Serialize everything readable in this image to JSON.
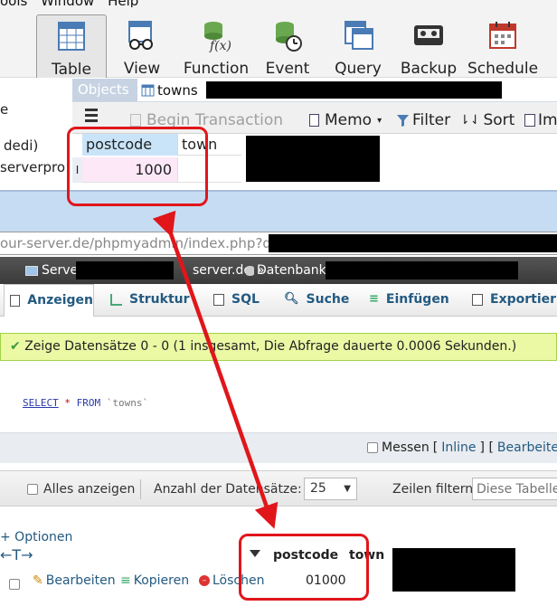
{
  "menubar": {
    "items": [
      "ools",
      "Window",
      "Help"
    ]
  },
  "toolbar": {
    "buttons": [
      {
        "label": "Table",
        "icon": "table-icon",
        "active": true
      },
      {
        "label": "View",
        "icon": "view-icon"
      },
      {
        "label": "Function",
        "icon": "function-icon"
      },
      {
        "label": "Event",
        "icon": "event-icon"
      },
      {
        "label": "Query",
        "icon": "query-icon"
      },
      {
        "label": "Backup",
        "icon": "backup-icon"
      },
      {
        "label": "Schedule",
        "icon": "schedule-icon"
      }
    ]
  },
  "left_tree": {
    "item1": "e",
    "item2": "dedi)",
    "item3": "serverpro"
  },
  "object_tabs": {
    "objects": "Objects",
    "towns": "towns"
  },
  "grid_toolbar": {
    "menu_icon": "hamburger-icon",
    "begin_transaction": "Begin Transaction",
    "memo": "Memo",
    "filter": "Filter",
    "sort": "Sort",
    "import": "Im"
  },
  "navicat_grid": {
    "columns": [
      "postcode",
      "town"
    ],
    "row_marker": "I",
    "rows": [
      {
        "postcode": "1000",
        "town": ""
      }
    ]
  },
  "browser": {
    "url_prefix": "our-server.de",
    "url_path": "/phpmyadmin/index.php?db=",
    "breadcrumb_server": "Serve",
    "breadcrumb_server_suffix": "server.de",
    "breadcrumb_sep": "»",
    "breadcrumb_db": "Datenbank:"
  },
  "pma_tabs": [
    {
      "label": "Anzeigen",
      "icon": "browse-icon",
      "active": true
    },
    {
      "label": "Struktur",
      "icon": "structure-icon"
    },
    {
      "label": "SQL",
      "icon": "sql-icon"
    },
    {
      "label": "Suche",
      "icon": "search-icon"
    },
    {
      "label": "Einfügen",
      "icon": "insert-icon"
    },
    {
      "label": "Exportier",
      "icon": "export-icon"
    }
  ],
  "success_message": "Zeige Datensätze 0 - 0 (1 insgesamt, Die Abfrage dauerte 0.0006 Sekunden.)",
  "sql": {
    "keyword1": "SELECT",
    "star": "*",
    "keyword2": "FROM",
    "table": "`towns`"
  },
  "options_bar": {
    "messen": "Messen",
    "bracket_open": "[",
    "inline": "Inline",
    "sep": "] [",
    "bearbeiten": "Bearbeiten"
  },
  "nav_bar": {
    "show_all": "Alles anzeigen",
    "rows_label": "Anzahl der Datensätze:",
    "rows_value": "25",
    "filter_label": "Zeilen filtern:",
    "filter_placeholder": "Diese Tabelle durchsuchen"
  },
  "result": {
    "options_link": "+ Optionen",
    "arrows": "←T→",
    "sort_icon": "sort-triangle-icon",
    "columns": [
      "postcode",
      "town"
    ],
    "actions": {
      "edit": "Bearbeiten",
      "copy": "Kopieren",
      "delete": "Löschen"
    },
    "rows": [
      {
        "postcode": "01000"
      }
    ]
  },
  "colors": {
    "annotation_red": "#e0161b",
    "pma_link": "#235a81",
    "success_bg": "#ebf8a4",
    "band_blue": "#c6dcf3"
  }
}
